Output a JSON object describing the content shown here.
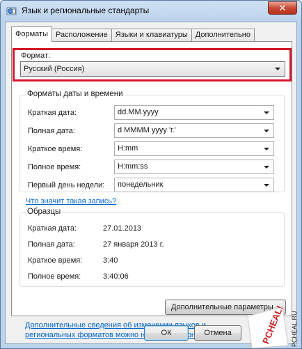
{
  "window": {
    "title": "Язык и региональные стандарты",
    "close_label": "✕"
  },
  "tabs": [
    {
      "label": "Форматы",
      "active": true
    },
    {
      "label": "Расположение",
      "active": false
    },
    {
      "label": "Языки и клавиатуры",
      "active": false
    },
    {
      "label": "Дополнительно",
      "active": false
    }
  ],
  "format": {
    "label": "Формат:",
    "value": "Русский (Россия)"
  },
  "datetime": {
    "title": "Форматы даты и времени",
    "fields": [
      {
        "label": "Краткая дата:",
        "value": "dd.MM.yyyy"
      },
      {
        "label": "Полная дата:",
        "value": "d MMMM yyyy 'г.'"
      },
      {
        "label": "Краткое время:",
        "value": "H:mm"
      },
      {
        "label": "Полное время:",
        "value": "H:mm:ss"
      },
      {
        "label": "Первый день недели:",
        "value": "понедельник"
      }
    ],
    "help_link": "Что значит такая запись?"
  },
  "samples": {
    "title": "Образцы",
    "rows": [
      {
        "label": "Краткая дата:",
        "value": "27.01.2013"
      },
      {
        "label": "Полная дата:",
        "value": "27 января 2013 г."
      },
      {
        "label": "Краткое время:",
        "value": "3:40"
      },
      {
        "label": "Полное время:",
        "value": "3:40:06"
      }
    ]
  },
  "advanced_button": "Дополнительные параметры...",
  "footer_link": "Дополнительные сведения об изменении языков и региональных форматов можно найти в Интернете",
  "buttons": {
    "ok": "ОК",
    "cancel": "Отмена"
  },
  "watermark": {
    "text": "PCHEAL!",
    "side_text": "PCHEAL.RU"
  },
  "colors": {
    "highlight_border": "#d1162a",
    "link": "#0066cc"
  }
}
